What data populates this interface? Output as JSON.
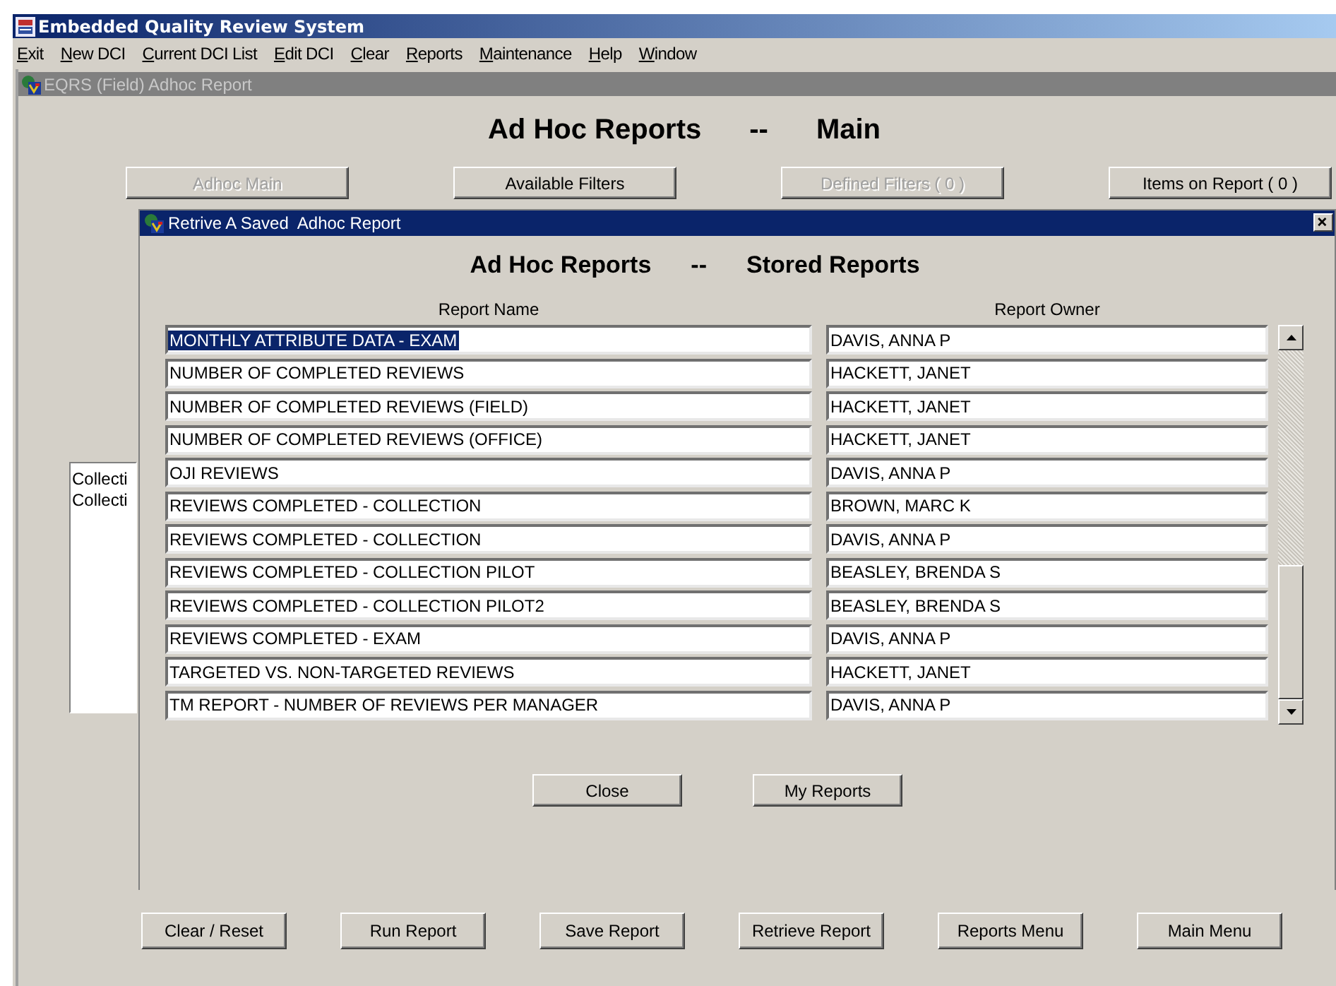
{
  "window": {
    "title": "Embedded Quality Review System"
  },
  "menu": [
    {
      "label": "Exit"
    },
    {
      "label": "New DCI"
    },
    {
      "label": "Current DCI List"
    },
    {
      "label": "Edit DCI"
    },
    {
      "label": "Clear"
    },
    {
      "label": "Reports"
    },
    {
      "label": "Maintenance"
    },
    {
      "label": "Help"
    },
    {
      "label": "Window"
    }
  ],
  "child_window": {
    "title": "EQRS (Field) Adhoc Report",
    "heading_left": "Ad Hoc Reports",
    "heading_sep": "--",
    "heading_right": "Main"
  },
  "tabs": [
    {
      "label": "Adhoc Main",
      "disabled": true
    },
    {
      "label": "Available Filters",
      "disabled": false
    },
    {
      "label": "Defined Filters  ( 0 )",
      "disabled": true
    },
    {
      "label": "Items on Report  ( 0 )",
      "disabled": false
    }
  ],
  "side_list": [
    "Collecti",
    "Collecti"
  ],
  "dialog": {
    "title": "Retrive A Saved  Adhoc Report",
    "heading_left": "Ad Hoc Reports",
    "heading_sep": "--",
    "heading_right": "Stored Reports",
    "columns": [
      "Report Name",
      "Report Owner"
    ],
    "rows": [
      {
        "name": "MONTHLY ATTRIBUTE DATA - EXAM",
        "owner": "DAVIS, ANNA P",
        "selected": true
      },
      {
        "name": "NUMBER OF COMPLETED REVIEWS",
        "owner": "HACKETT, JANET",
        "selected": false
      },
      {
        "name": "NUMBER OF COMPLETED REVIEWS (FIELD)",
        "owner": "HACKETT, JANET",
        "selected": false
      },
      {
        "name": "NUMBER OF COMPLETED REVIEWS (OFFICE)",
        "owner": "HACKETT, JANET",
        "selected": false
      },
      {
        "name": "OJI REVIEWS",
        "owner": "DAVIS, ANNA P",
        "selected": false
      },
      {
        "name": "REVIEWS COMPLETED - COLLECTION",
        "owner": "BROWN, MARC K",
        "selected": false
      },
      {
        "name": "REVIEWS COMPLETED - COLLECTION",
        "owner": "DAVIS, ANNA P",
        "selected": false
      },
      {
        "name": "REVIEWS COMPLETED - COLLECTION PILOT",
        "owner": "BEASLEY, BRENDA S",
        "selected": false
      },
      {
        "name": "REVIEWS COMPLETED - COLLECTION PILOT2",
        "owner": "BEASLEY, BRENDA S",
        "selected": false
      },
      {
        "name": "REVIEWS COMPLETED - EXAM",
        "owner": "DAVIS, ANNA P",
        "selected": false
      },
      {
        "name": "TARGETED VS. NON-TARGETED REVIEWS",
        "owner": "HACKETT, JANET",
        "selected": false
      },
      {
        "name": "TM REPORT - NUMBER OF REVIEWS PER MANAGER",
        "owner": "DAVIS, ANNA P",
        "selected": false
      }
    ],
    "buttons": [
      "Close",
      "My Reports"
    ]
  },
  "bottom_buttons": [
    "Clear / Reset",
    "Run Report",
    "Save Report",
    "Retrieve Report",
    "Reports Menu",
    "Main Menu"
  ]
}
